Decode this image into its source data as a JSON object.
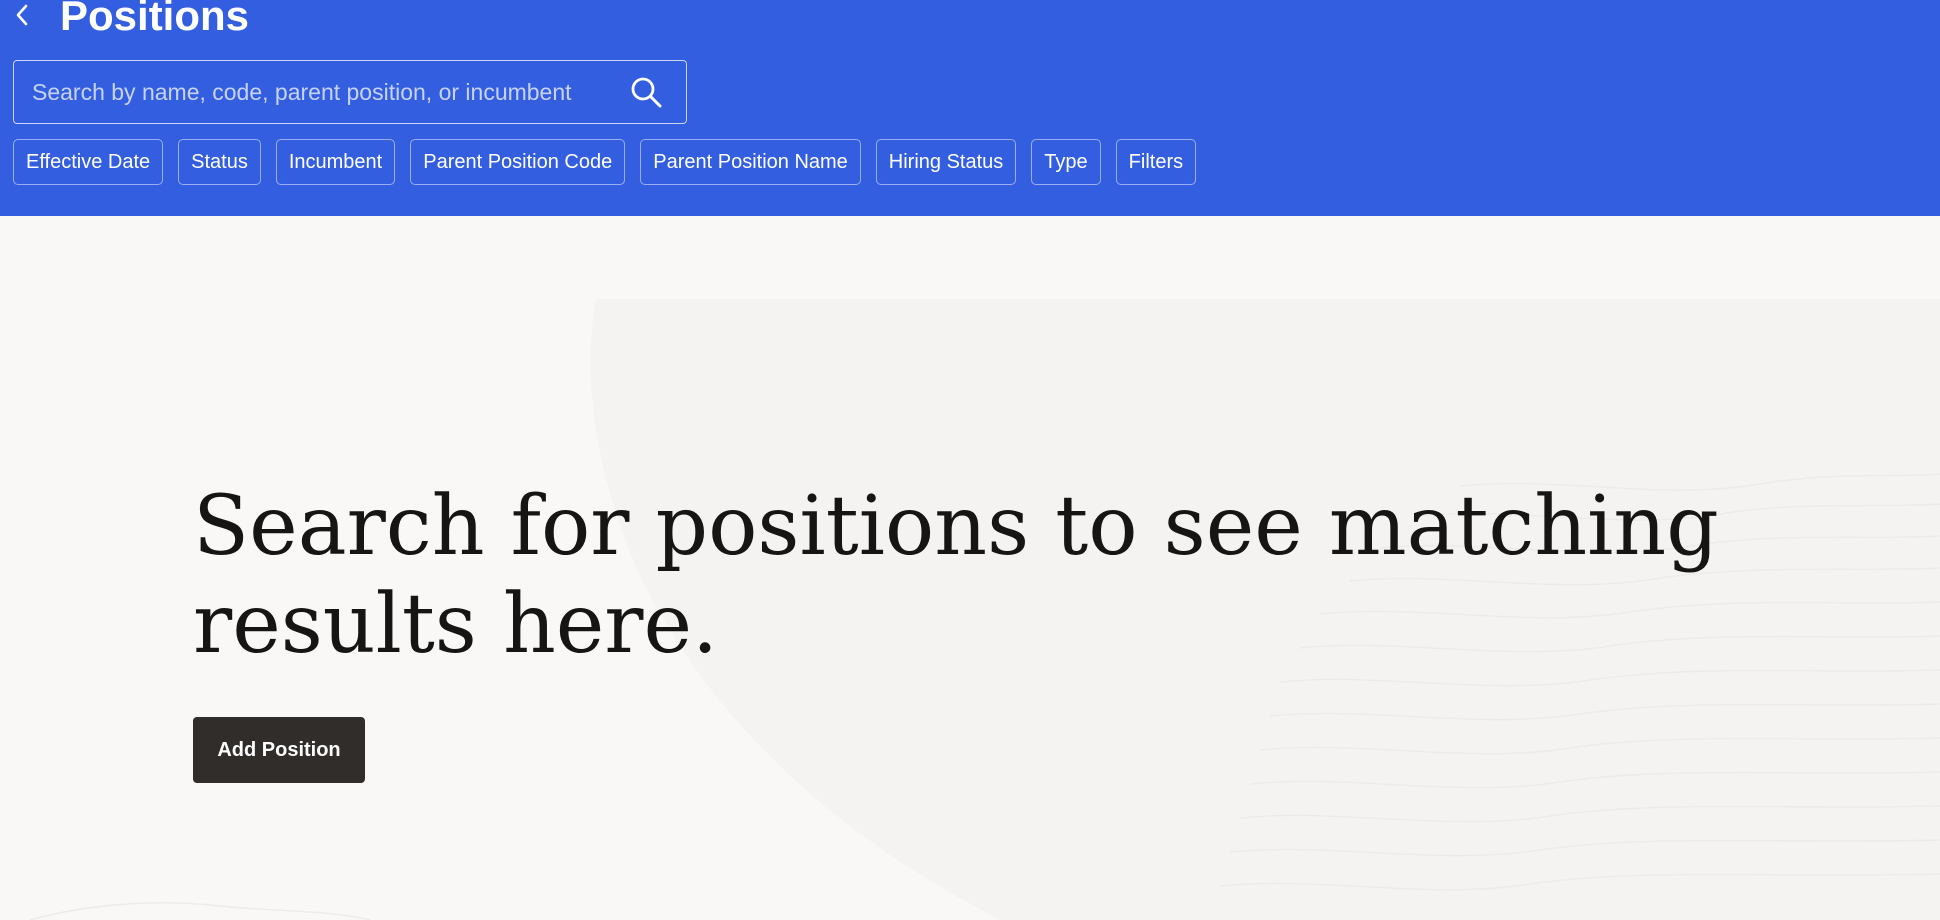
{
  "header": {
    "title": "Positions",
    "back_icon": "chevron-left-icon",
    "background_color": "#335ee0"
  },
  "search": {
    "placeholder": "Search by name, code, parent position, or incumbent",
    "value": "",
    "icon": "search-icon"
  },
  "filters": [
    {
      "label": "Effective Date"
    },
    {
      "label": "Status"
    },
    {
      "label": "Incumbent"
    },
    {
      "label": "Parent Position Code"
    },
    {
      "label": "Parent Position Name"
    },
    {
      "label": "Hiring Status"
    },
    {
      "label": "Type"
    },
    {
      "label": "Filters"
    }
  ],
  "empty_state": {
    "message": "Search for positions to see matching results here.",
    "button_label": "Add Position",
    "button_color": "#312d2a"
  }
}
